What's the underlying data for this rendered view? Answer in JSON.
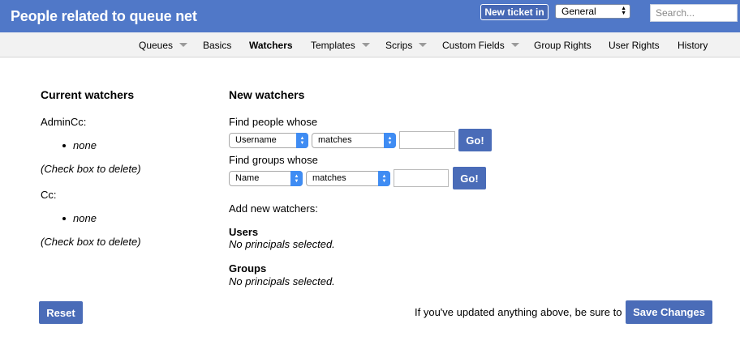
{
  "header": {
    "title": "People related to queue net",
    "new_ticket_label": "New ticket in",
    "queue_selected": "General",
    "search_placeholder": "Search..."
  },
  "nav": {
    "items": [
      {
        "label": "Queues",
        "has_dropdown": true
      },
      {
        "label": "Basics",
        "has_dropdown": false
      },
      {
        "label": "Watchers",
        "has_dropdown": false,
        "active": true
      },
      {
        "label": "Templates",
        "has_dropdown": true
      },
      {
        "label": "Scrips",
        "has_dropdown": true
      },
      {
        "label": "Custom Fields",
        "has_dropdown": true
      },
      {
        "label": "Group Rights",
        "has_dropdown": false
      },
      {
        "label": "User Rights",
        "has_dropdown": false
      },
      {
        "label": "History",
        "has_dropdown": false
      }
    ]
  },
  "current_watchers": {
    "heading": "Current watchers",
    "groups": [
      {
        "label": "AdminCc:",
        "value": "none",
        "hint": "(Check box to delete)"
      },
      {
        "label": "Cc:",
        "value": "none",
        "hint": "(Check box to delete)"
      }
    ]
  },
  "new_watchers": {
    "heading": "New watchers",
    "find_people_label": "Find people whose",
    "people_field": "Username",
    "people_op": "matches",
    "people_go": "Go!",
    "find_groups_label": "Find groups whose",
    "groups_field": "Name",
    "groups_op": "matches",
    "groups_go": "Go!",
    "add_label": "Add new watchers:",
    "users_heading": "Users",
    "users_empty": "No principals selected.",
    "groups_heading": "Groups",
    "groups_empty": "No principals selected."
  },
  "footer": {
    "reset_label": "Reset",
    "reminder": "If you've updated anything above, be sure to",
    "save_label": "Save Changes"
  },
  "colors": {
    "header_bg": "#5078c8",
    "button_bg": "#4a6cb8",
    "select_stepper": "#3f8cf3"
  }
}
